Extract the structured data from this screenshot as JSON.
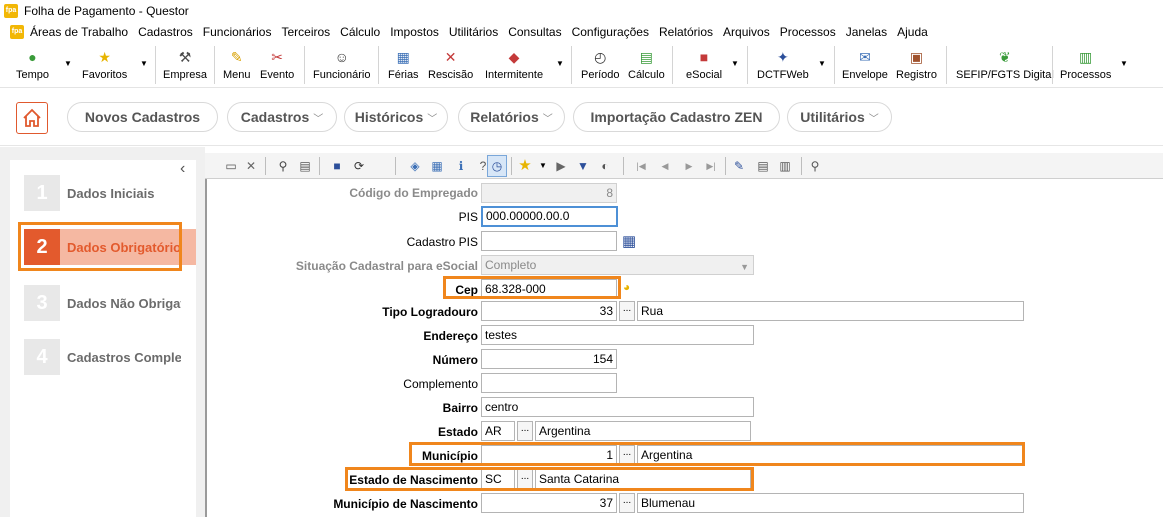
{
  "window": {
    "title": "Folha de Pagamento - Questor",
    "logo_text": "fpa"
  },
  "menu": [
    "Áreas de Trabalho",
    "Cadastros",
    "Funcionários",
    "Terceiros",
    "Cálculo",
    "Impostos",
    "Utilitários",
    "Consultas",
    "Configurações",
    "Relatórios",
    "Arquivos",
    "Processos",
    "Janelas",
    "Ajuda"
  ],
  "toolbar": {
    "tempo": "Tempo",
    "favoritos": "Favoritos",
    "empresa": "Empresa",
    "menu": "Menu",
    "evento": "Evento",
    "funcionario": "Funcionário",
    "ferias": "Férias",
    "rescisao": "Rescisão",
    "intermitente": "Intermitente",
    "periodo": "Período",
    "calculo": "Cálculo",
    "esocial": "eSocial",
    "dctfweb": "DCTFWeb",
    "envelope": "Envelope",
    "registro": "Registro",
    "sefip": "SEFIP/FGTS Digital",
    "processos": "Processos"
  },
  "nav": {
    "novos_cadastros": "Novos Cadastros",
    "cadastros": "Cadastros",
    "historicos": "Históricos",
    "relatorios": "Relatórios",
    "importacao": "Importação Cadastro ZEN",
    "utilitarios": "Utilitários"
  },
  "wizard": [
    {
      "num": "1",
      "label": "Dados Iniciais"
    },
    {
      "num": "2",
      "label": "Dados Obrigatórios"
    },
    {
      "num": "3",
      "label": "Dados Não Obrigatórios"
    },
    {
      "num": "4",
      "label": "Cadastros Complementares"
    }
  ],
  "form": {
    "codigo_empregado": {
      "label": "Código do Empregado",
      "value": "8"
    },
    "pis": {
      "label": "PIS",
      "value": "000.00000.00.0"
    },
    "cadastro_pis": {
      "label": "Cadastro PIS",
      "value": ""
    },
    "situacao": {
      "label": "Situação Cadastral para eSocial",
      "value": "Completo"
    },
    "cep": {
      "label": "Cep",
      "value": "68.328-000"
    },
    "tipo_logradouro": {
      "label": "Tipo Logradouro",
      "code": "33",
      "desc": "Rua"
    },
    "endereco": {
      "label": "Endereço",
      "value": "testes"
    },
    "numero": {
      "label": "Número",
      "value": "154"
    },
    "complemento": {
      "label": "Complemento",
      "value": ""
    },
    "bairro": {
      "label": "Bairro",
      "value": "centro"
    },
    "estado": {
      "label": "Estado",
      "code": "AR",
      "desc": "Argentina"
    },
    "municipio": {
      "label": "Município",
      "code": "1",
      "desc": "Argentina"
    },
    "estado_nascimento": {
      "label": "Estado de Nascimento",
      "code": "SC",
      "desc": "Santa Catarina"
    },
    "municipio_nascimento": {
      "label": "Município de Nascimento",
      "code": "37",
      "desc": "Blumenau"
    }
  },
  "colors": {
    "accent": "#e35a2d",
    "highlight": "#f0861c",
    "focus": "#4d90d6"
  }
}
